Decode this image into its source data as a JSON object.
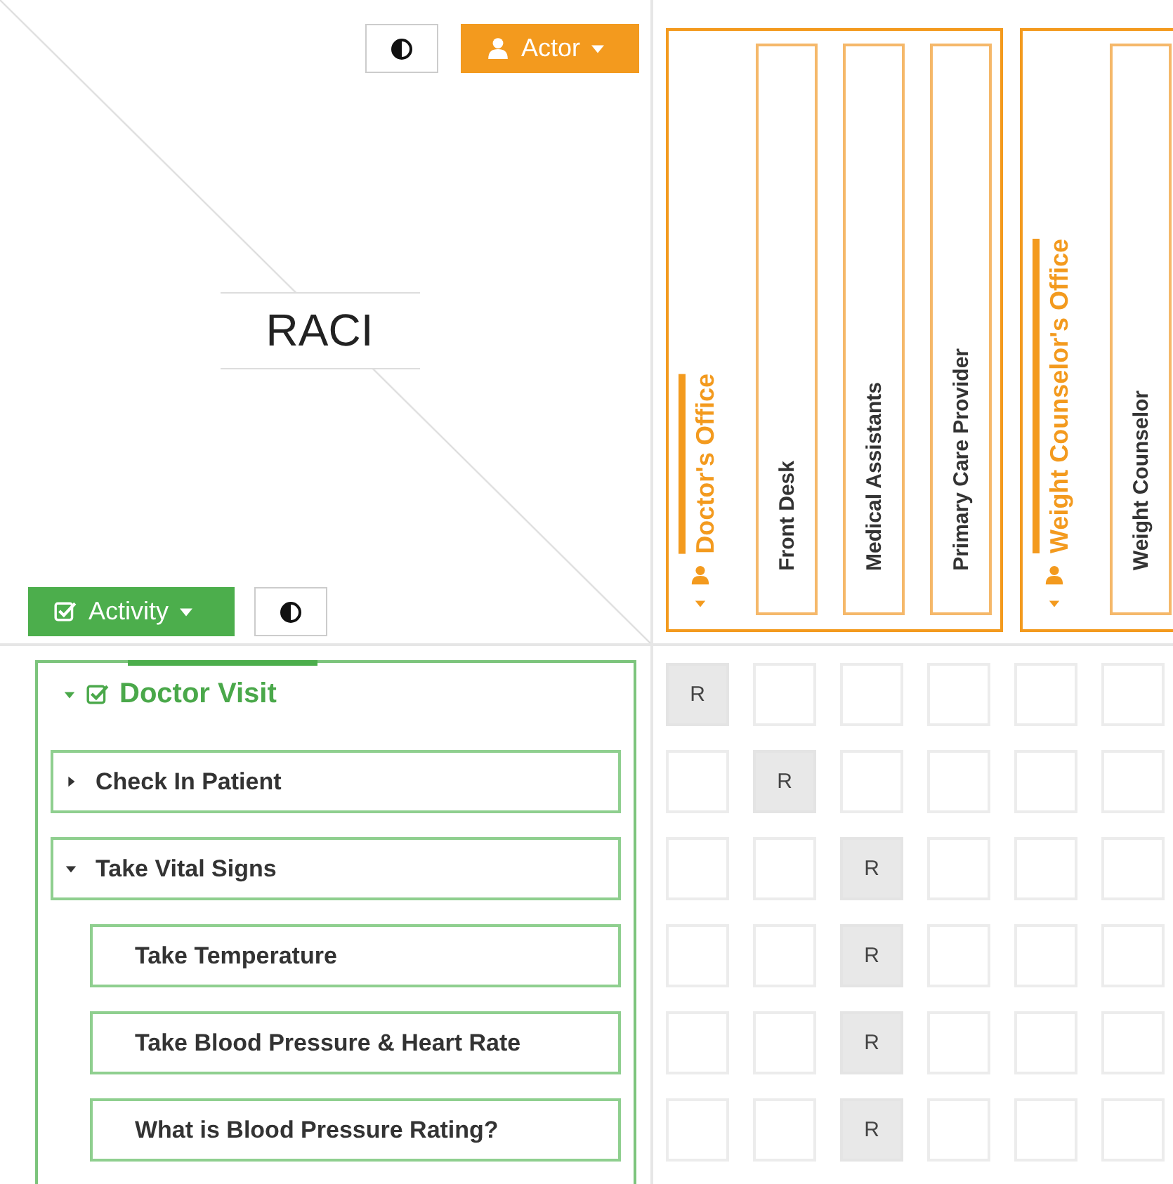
{
  "corner": {
    "title": "RACI"
  },
  "actor_button": {
    "label": "Actor"
  },
  "activity_button": {
    "label": "Activity"
  },
  "groups": [
    {
      "name": "Doctor's Office",
      "expanded": true,
      "roles": [
        {
          "name": "Front Desk"
        },
        {
          "name": "Medical Assistants"
        },
        {
          "name": "Primary Care Provider"
        }
      ]
    },
    {
      "name": "Weight Counselor's Office",
      "expanded": true,
      "roles": [
        {
          "name": "Weight Counselor"
        }
      ]
    }
  ],
  "activities": [
    {
      "name": "Doctor Visit",
      "expanded": true,
      "cells": [
        "R",
        null,
        null,
        null,
        null,
        null
      ],
      "children": [
        {
          "name": "Check In Patient",
          "expanded": false,
          "cells": [
            null,
            "R",
            null,
            null,
            null,
            null
          ]
        },
        {
          "name": "Take Vital Signs",
          "expanded": true,
          "cells": [
            null,
            null,
            "R",
            null,
            null,
            null
          ],
          "children": [
            {
              "name": "Take Temperature",
              "cells": [
                null,
                null,
                "R",
                null,
                null,
                null
              ]
            },
            {
              "name": "Take Blood Pressure & Heart Rate",
              "cells": [
                null,
                null,
                "R",
                null,
                null,
                null
              ]
            },
            {
              "name": "What is Blood Pressure Rating?",
              "cells": [
                null,
                null,
                "R",
                null,
                null,
                null
              ]
            }
          ]
        }
      ]
    }
  ]
}
